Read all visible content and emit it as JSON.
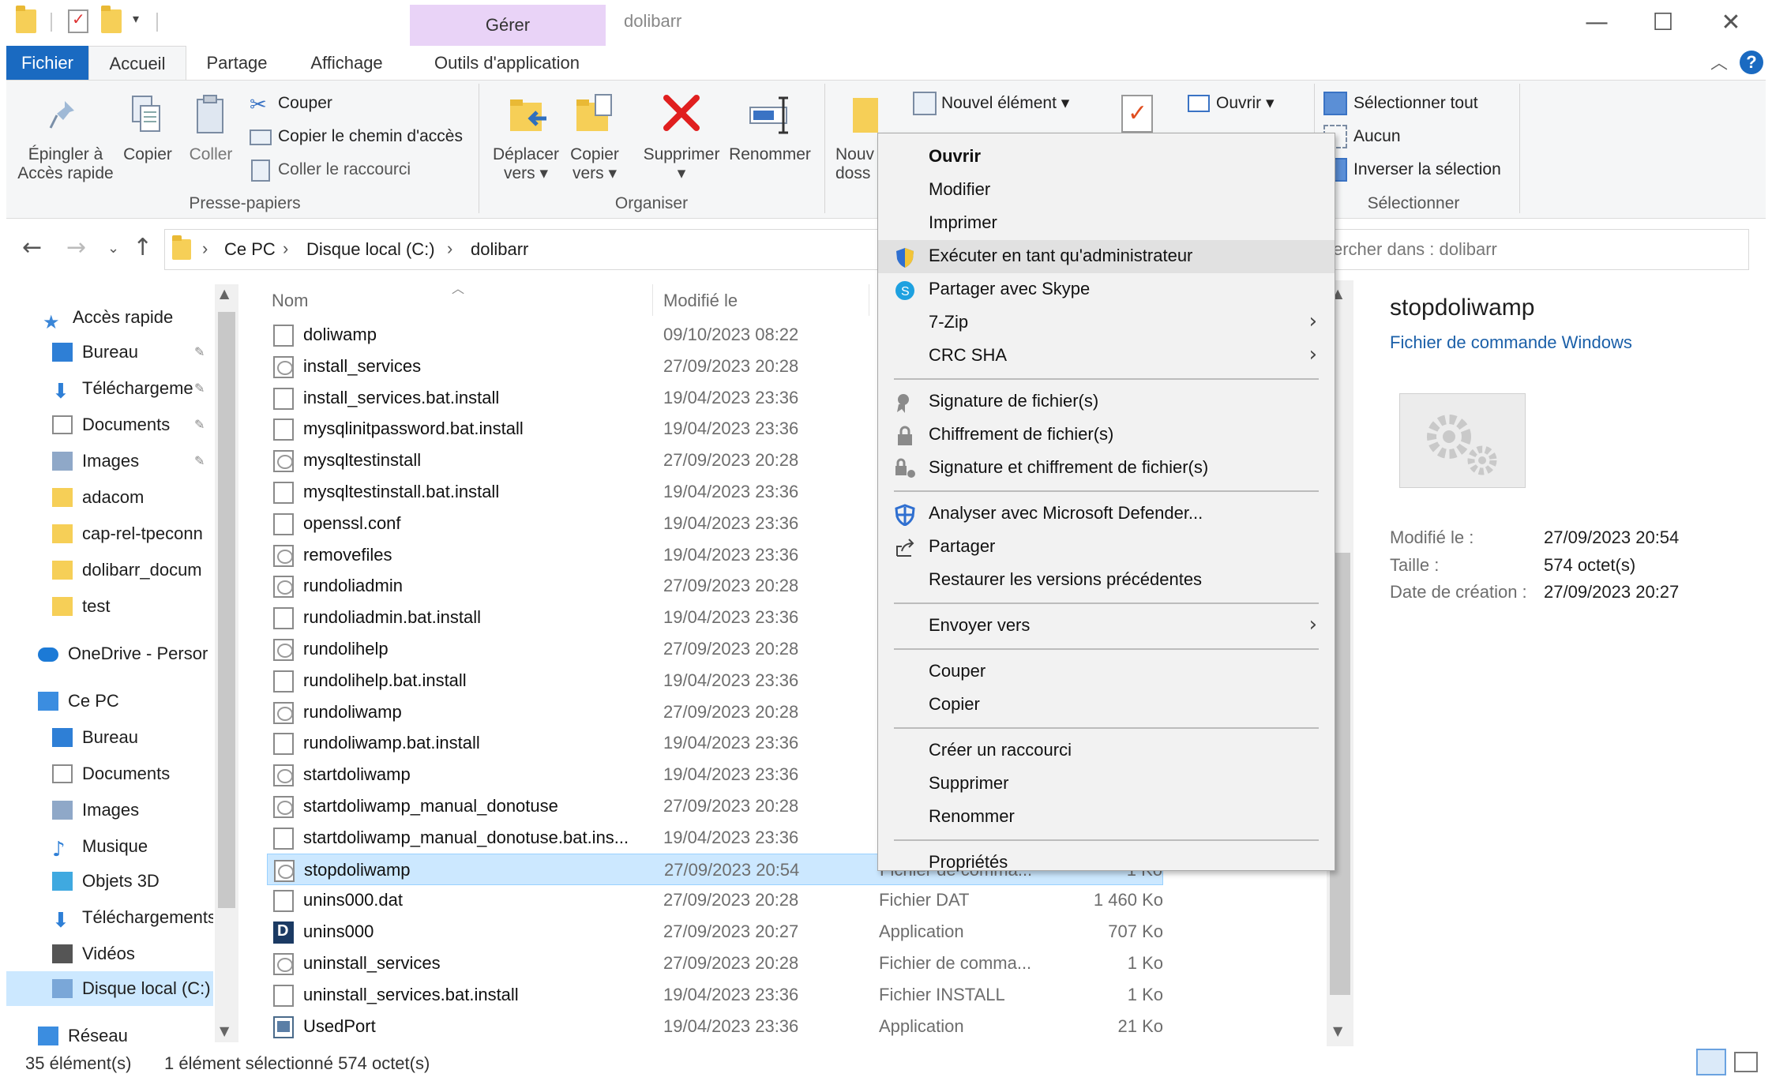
{
  "titlebar": {
    "manage_tab": "Gérer",
    "window_title": "dolibarr",
    "minimize_glyph": "—",
    "maximize_glyph": "☐",
    "close_glyph": "✕"
  },
  "ribbon_tabs": {
    "file": "Fichier",
    "home": "Accueil",
    "share": "Partage",
    "view": "Affichage",
    "app_tools": "Outils d'application",
    "help_glyph": "?"
  },
  "ribbon": {
    "pin_label_1": "Épingler à",
    "pin_label_2": "Accès rapide",
    "copy": "Copier",
    "paste": "Coller",
    "cut": "Couper",
    "copy_path": "Copier le chemin d'accès",
    "paste_shortcut": "Coller le raccourci",
    "clipboard_group": "Presse-papiers",
    "move_to_1": "Déplacer",
    "move_to_2": "vers ▾",
    "copy_to_1": "Copier",
    "copy_to_2": "vers ▾",
    "delete": "Supprimer",
    "delete_arrow": "▾",
    "rename": "Renommer",
    "organize_group": "Organiser",
    "new_folder_1": "Nouv",
    "new_folder_2": "doss",
    "new_item": "Nouvel élément ▾",
    "open": "Ouvrir ▾",
    "select_all": "Sélectionner tout",
    "select_none": "Aucun",
    "invert_selection": "Inverser la sélection",
    "select_group": "Sélectionner"
  },
  "address": {
    "crumbs": [
      "Ce PC",
      "Disque local (C:)",
      "dolibarr"
    ],
    "separator": "›",
    "search_placeholder": "ercher dans : dolibarr"
  },
  "nav_pane": {
    "items": [
      {
        "label": "Accès rapide",
        "icon": "star-icon"
      },
      {
        "label": "Bureau",
        "icon": "desktop-icon",
        "pinned": true
      },
      {
        "label": "Téléchargeme",
        "icon": "download-icon",
        "pinned": true
      },
      {
        "label": "Documents",
        "icon": "documents-icon",
        "pinned": true
      },
      {
        "label": "Images",
        "icon": "images-icon",
        "pinned": true
      },
      {
        "label": "adacom",
        "icon": "folder-icon"
      },
      {
        "label": "cap-rel-tpeconn",
        "icon": "folder-icon"
      },
      {
        "label": "dolibarr_docum",
        "icon": "folder-icon"
      },
      {
        "label": "test",
        "icon": "folder-icon"
      },
      {
        "label": "OneDrive - Persor",
        "icon": "cloud-icon"
      },
      {
        "label": "Ce PC",
        "icon": "computer-icon"
      },
      {
        "label": "Bureau",
        "icon": "desktop-icon"
      },
      {
        "label": "Documents",
        "icon": "documents-icon"
      },
      {
        "label": "Images",
        "icon": "images-icon"
      },
      {
        "label": "Musique",
        "icon": "music-icon"
      },
      {
        "label": "Objets 3D",
        "icon": "cube-icon"
      },
      {
        "label": "Téléchargements",
        "icon": "download-icon"
      },
      {
        "label": "Vidéos",
        "icon": "video-icon"
      },
      {
        "label": "Disque local (C:)",
        "icon": "drive-icon"
      },
      {
        "label": "Réseau",
        "icon": "network-icon"
      }
    ],
    "pin_glyph": "📌"
  },
  "file_list": {
    "columns": {
      "name": "Nom",
      "modified": "Modifié le"
    },
    "rows": [
      {
        "name": "doliwamp",
        "date": "09/10/2023 08:22",
        "type": "",
        "size": "",
        "icon": "doc"
      },
      {
        "name": "install_services",
        "date": "27/09/2023 20:28",
        "type": "",
        "size": "",
        "icon": "bat"
      },
      {
        "name": "install_services.bat.install",
        "date": "19/04/2023 23:36",
        "type": "",
        "size": "",
        "icon": "doc"
      },
      {
        "name": "mysqlinitpassword.bat.install",
        "date": "19/04/2023 23:36",
        "type": "",
        "size": "",
        "icon": "doc"
      },
      {
        "name": "mysqltestinstall",
        "date": "27/09/2023 20:28",
        "type": "",
        "size": "",
        "icon": "bat"
      },
      {
        "name": "mysqltestinstall.bat.install",
        "date": "19/04/2023 23:36",
        "type": "",
        "size": "",
        "icon": "doc"
      },
      {
        "name": "openssl.conf",
        "date": "19/04/2023 23:36",
        "type": "",
        "size": "",
        "icon": "doc"
      },
      {
        "name": "removefiles",
        "date": "19/04/2023 23:36",
        "type": "",
        "size": "",
        "icon": "bat"
      },
      {
        "name": "rundoliadmin",
        "date": "27/09/2023 20:28",
        "type": "",
        "size": "",
        "icon": "bat"
      },
      {
        "name": "rundoliadmin.bat.install",
        "date": "19/04/2023 23:36",
        "type": "",
        "size": "",
        "icon": "doc"
      },
      {
        "name": "rundolihelp",
        "date": "27/09/2023 20:28",
        "type": "",
        "size": "",
        "icon": "bat"
      },
      {
        "name": "rundolihelp.bat.install",
        "date": "19/04/2023 23:36",
        "type": "",
        "size": "",
        "icon": "doc"
      },
      {
        "name": "rundoliwamp",
        "date": "27/09/2023 20:28",
        "type": "",
        "size": "",
        "icon": "bat"
      },
      {
        "name": "rundoliwamp.bat.install",
        "date": "19/04/2023 23:36",
        "type": "",
        "size": "",
        "icon": "doc"
      },
      {
        "name": "startdoliwamp",
        "date": "19/04/2023 23:36",
        "type": "",
        "size": "",
        "icon": "bat"
      },
      {
        "name": "startdoliwamp_manual_donotuse",
        "date": "27/09/2023 20:28",
        "type": "",
        "size": "",
        "icon": "bat"
      },
      {
        "name": "startdoliwamp_manual_donotuse.bat.ins...",
        "date": "19/04/2023 23:36",
        "type": "",
        "size": "",
        "icon": "doc"
      },
      {
        "name": "stopdoliwamp",
        "date": "27/09/2023 20:54",
        "type": "Fichier de comma...",
        "size": "1 Ko",
        "icon": "bat",
        "selected": true
      },
      {
        "name": "unins000.dat",
        "date": "27/09/2023 20:28",
        "type": "Fichier DAT",
        "size": "1 460 Ko",
        "icon": "doc"
      },
      {
        "name": "unins000",
        "date": "27/09/2023 20:27",
        "type": "Application",
        "size": "707 Ko",
        "icon": "app"
      },
      {
        "name": "uninstall_services",
        "date": "27/09/2023 20:28",
        "type": "Fichier de comma...",
        "size": "1 Ko",
        "icon": "bat"
      },
      {
        "name": "uninstall_services.bat.install",
        "date": "19/04/2023 23:36",
        "type": "Fichier INSTALL",
        "size": "1 Ko",
        "icon": "doc"
      },
      {
        "name": "UsedPort",
        "date": "19/04/2023 23:36",
        "type": "Application",
        "size": "21 Ko",
        "icon": "up"
      }
    ]
  },
  "preview": {
    "title": "stopdoliwamp",
    "subtitle": "Fichier de commande Windows",
    "modified_label": "Modifié le :",
    "modified_value": "27/09/2023 20:54",
    "size_label": "Taille :",
    "size_value": "574 octet(s)",
    "created_label": "Date de création :",
    "created_value": "27/09/2023 20:27"
  },
  "status": {
    "count": "35 élément(s)",
    "selection": "1 élément sélectionné  574 octet(s)"
  },
  "context_menu": {
    "items": [
      {
        "label": "Ouvrir",
        "bold": true
      },
      {
        "label": "Modifier"
      },
      {
        "label": "Imprimer"
      },
      {
        "label": "Exécuter en tant qu'administrateur",
        "icon": "shield-icon",
        "hover": true
      },
      {
        "label": "Partager avec Skype",
        "icon": "skype-icon"
      },
      {
        "label": "7-Zip",
        "submenu": true
      },
      {
        "label": "CRC SHA",
        "submenu": true
      },
      {
        "label": "Signature de fichier(s)",
        "icon": "signature-icon",
        "sep_before": true
      },
      {
        "label": "Chiffrement de fichier(s)",
        "icon": "lock-icon"
      },
      {
        "label": "Signature et chiffrement de fichier(s)",
        "icon": "sign-lock-icon"
      },
      {
        "label": "Analyser avec Microsoft Defender...",
        "icon": "defender-icon",
        "sep_before": true
      },
      {
        "label": "Partager",
        "icon": "share-icon"
      },
      {
        "label": "Restaurer les versions précédentes"
      },
      {
        "label": "Envoyer vers",
        "submenu": true,
        "sep_before": true
      },
      {
        "label": "Couper",
        "sep_before": true
      },
      {
        "label": "Copier"
      },
      {
        "label": "Créer un raccourci",
        "sep_before": true
      },
      {
        "label": "Supprimer"
      },
      {
        "label": "Renommer"
      },
      {
        "label": "Propriétés",
        "sep_before": true
      }
    ],
    "submenu_glyph": "›"
  },
  "colors": {
    "accent": "#1a6ac1",
    "manage_tab": "#e9d3f7",
    "selection": "#cce8ff"
  }
}
